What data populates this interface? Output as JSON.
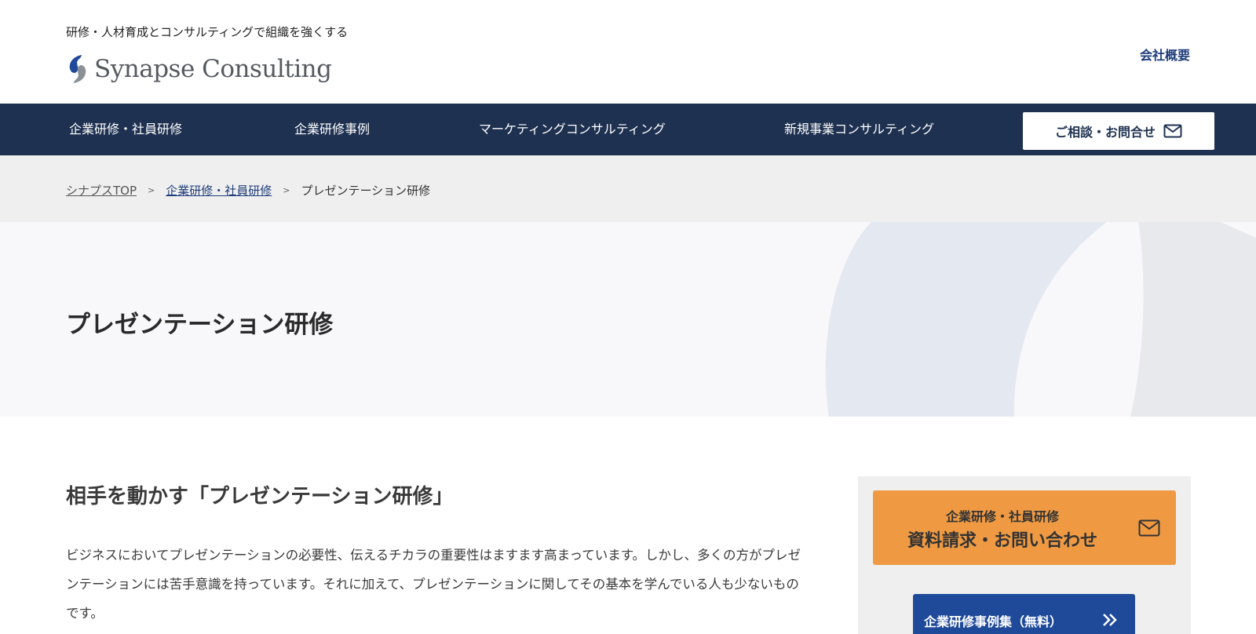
{
  "header": {
    "tagline": "研修・人材育成とコンサルティングで組織を強くする",
    "logo_text": "Synapse Consulting",
    "company_link": "会社概要"
  },
  "nav": {
    "items": [
      "企業研修・社員研修",
      "企業研修事例",
      "マーケティングコンサルティング",
      "新規事業コンサルティング"
    ],
    "cta_label": "ご相談・お問合せ"
  },
  "breadcrumb": {
    "home": "シナプスTOP",
    "parent": "企業研修・社員研修",
    "current": "プレゼンテーション研修",
    "separator": ">"
  },
  "hero": {
    "title": "プレゼンテーション研修"
  },
  "main": {
    "section_title": "相手を動かす「プレゼンテーション研修」",
    "body": "ビジネスにおいてプレゼンテーションの必要性、伝えるチカラの重要性はますます高まっています。しかし、多くの方がプレゼンテーションには苦手意識を持っています。それに加えて、プレゼンテーションに関してその基本を学んでいる人も少ないものです。"
  },
  "sidebar": {
    "cta_sub": "企業研修・社員研修",
    "cta_main": "資料請求・お問い合わせ",
    "case_label": "企業研修事例集（無料）"
  },
  "colors": {
    "nav_bg": "#1e3151",
    "accent_blue": "#1f3d7a",
    "cta_orange": "#ef9a43",
    "case_blue": "#1f4a9a"
  }
}
